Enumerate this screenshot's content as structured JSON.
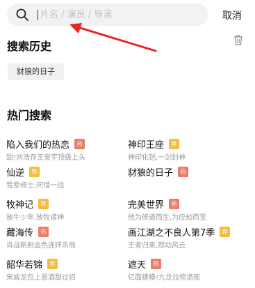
{
  "search": {
    "placeholder": "片名 / 演员 / 导演",
    "cancel_label": "取消"
  },
  "history": {
    "title": "搜索历史",
    "items": [
      "豺狼的日子"
    ]
  },
  "hot": {
    "title": "热门搜索",
    "items": [
      {
        "name": "陷入我们的热恋",
        "badge": "热",
        "badge_type": "hot",
        "desc": "甜!刘浩存王安宇顶级上头"
      },
      {
        "name": "神印王座",
        "badge": "荐",
        "badge_type": "rec",
        "desc": "神印化铠,一剑封神"
      },
      {
        "name": "仙逆",
        "badge": "荐",
        "badge_type": "rec",
        "desc": "我辈修士,何惜一战"
      },
      {
        "name": "豺狼的日子",
        "badge": "热",
        "badge_type": "hot",
        "desc": ""
      },
      {
        "name": "牧神记",
        "badge": "荐",
        "badge_type": "rec",
        "desc": "放牛少年,放牧诸神"
      },
      {
        "name": "完美世界",
        "badge": "热",
        "badge_type": "hot",
        "desc": "他为修道而生,为应劫而至"
      },
      {
        "name": "藏海传",
        "badge": "热",
        "badge_type": "hot",
        "desc": "肖战新剧血色连环杀局"
      },
      {
        "name": "画江湖之不良人第7季",
        "badge": "荐",
        "badge_type": "rec",
        "desc": "王者归来,搅动风云"
      },
      {
        "name": "韶华若锦",
        "badge": "荐",
        "badge_type": "rec",
        "desc": "宋威龙包上恩酒甜过招"
      },
      {
        "name": "遮天",
        "badge": "热",
        "badge_type": "hot",
        "desc": "亿面建模!九龙拉棺诡现"
      }
    ]
  },
  "colors": {
    "hot_badge": "#ec7c6b",
    "rec_badge": "#f4bd3f",
    "arrow": "#e8261d"
  }
}
